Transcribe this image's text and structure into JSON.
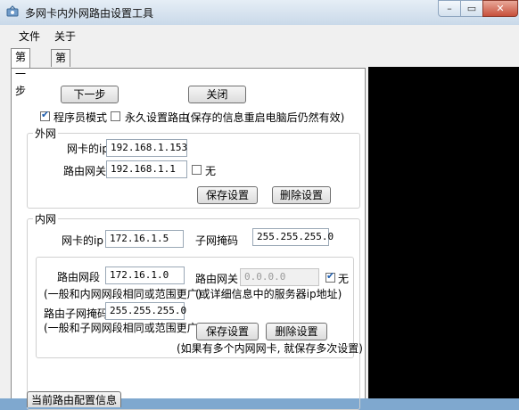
{
  "window": {
    "title": "多网卡内外网路由设置工具",
    "minimize": "–",
    "maximize": "▭",
    "close": "✕"
  },
  "menu": {
    "file": "文件",
    "about": "关于"
  },
  "tabs": [
    "第一步",
    "第二步"
  ],
  "top": {
    "next_btn": "下一步",
    "close_btn": "关闭",
    "programmer_mode": "程序员模式",
    "programmer_mode_checked": true,
    "permanent_route": "永久设置路由",
    "permanent_route_checked": false,
    "permanent_note": "(保存的信息重启电脑后仍然有效)"
  },
  "wan": {
    "title": "外网",
    "nic_ip_label": "网卡的ip",
    "nic_ip": "192.168.1.153",
    "gateway_label": "路由网关",
    "gateway": "192.168.1.1",
    "none_label": "无",
    "none_checked": false,
    "save_btn": "保存设置",
    "delete_btn": "删除设置"
  },
  "lan": {
    "title": "内网",
    "nic_ip_label": "网卡的ip",
    "nic_ip": "172.16.1.5",
    "subnet_label": "子网掩码",
    "subnet": "255.255.255.0",
    "route_segment_label": "路由网段",
    "route_segment": "172.16.1.0",
    "route_segment_hint": "(一般和内网网段相同或范围更广)",
    "route_gateway_label": "路由网关",
    "route_gateway": "0.0.0.0",
    "route_none_label": "无",
    "route_none_checked": true,
    "route_gateway_hint": "(或详细信息中的服务器ip地址)",
    "route_mask_label": "路由子网掩码",
    "route_mask": "255.255.255.0",
    "route_mask_hint": "(一般和子网网段相同或范围更广)",
    "save_btn": "保存设置",
    "delete_btn": "删除设置",
    "multi_note": "(如果有多个内网网卡, 就保存多次设置)"
  },
  "bottom_btn": "当前路由配置信息"
}
